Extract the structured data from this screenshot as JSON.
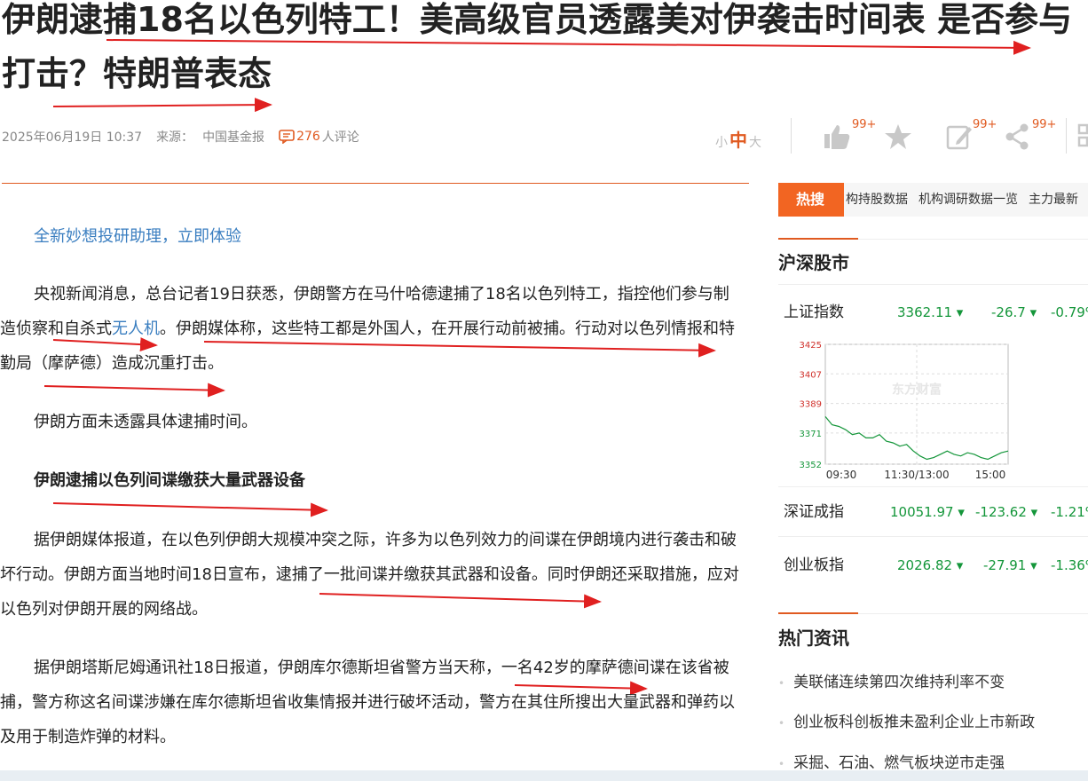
{
  "article": {
    "title": "伊朗逮捕18名以色列特工！美高级官员透露美对伊袭击时间表 是否参与打击？特朗普表态",
    "date": "2025年06月19日 10:37",
    "source_label": "来源：",
    "source": "中国基金报",
    "comment_count": "276",
    "comment_suffix": "人评论",
    "promo_link": "全新妙想投研助理，立即体验",
    "p1_a": "央视新闻消息，总台记者19日获悉，伊朗警方在马什哈德逮捕了18名以色列特工，指控他们参与制造侦察和自杀式",
    "p1_link": "无人机",
    "p1_b": "。伊朗媒体称，这些特工都是外国人，在开展行动前被捕。行动对以色列情报和特勤局（摩萨德）造成沉重打击。",
    "p2": "伊朗方面未透露具体逮捕时间。",
    "subheading": "伊朗逮捕以色列间谍缴获大量武器设备",
    "p3": "据伊朗媒体报道，在以色列伊朗大规模冲突之际，许多为以色列效力的间谍在伊朗境内进行袭击和破坏行动。伊朗方面当地时间18日宣布，逮捕了一批间谍并缴获其武器和设备。同时伊朗还采取措施，应对以色列对伊朗开展的网络战。",
    "p4": "据伊朗塔斯尼姆通讯社18日报道，伊朗库尔德斯坦省警方当天称，一名42岁的摩萨德间谍在该省被捕，警方称这名间谍涉嫌在库尔德斯坦省收集情报并进行破坏活动，警方在其住所搜出大量武器和弹药以及用于制造炸弹的材料。"
  },
  "font_size": {
    "small": "小",
    "medium": "中",
    "large": "大"
  },
  "toolbar": {
    "like_count": "99+",
    "edit_count": "99+",
    "share_count": "99+"
  },
  "hot": {
    "tag": "热搜",
    "links": [
      "构持股数据",
      "机构调研数据一览",
      "主力最新"
    ]
  },
  "market": {
    "title": "沪深股市",
    "indices": [
      {
        "name": "上证指数",
        "value": "3362.11",
        "change": "-26.7",
        "pct": "-0.79%"
      },
      {
        "name": "深证成指",
        "value": "10051.97",
        "change": "-123.62",
        "pct": "-1.21%"
      },
      {
        "name": "创业板指",
        "value": "2026.82",
        "change": "-27.91",
        "pct": "-1.36%"
      }
    ],
    "chart": {
      "y_ticks": [
        "3425",
        "3407",
        "3389",
        "3371",
        "3352"
      ],
      "x_ticks": [
        "09:30",
        "11:30/13:00",
        "15:00"
      ],
      "watermark": "东方财富"
    }
  },
  "news": {
    "title": "热门资讯",
    "items": [
      "美联储连续第四次维持利率不变",
      "创业板科创板推未盈利企业上市新政",
      "采掘、石油、燃气板块逆市走强"
    ]
  },
  "colors": {
    "accent": "#e05a20",
    "down": "#14963a",
    "link": "#3a7ec0",
    "hot_tag": "#f26522"
  },
  "chart_data": {
    "type": "line",
    "title": "",
    "x": [
      "09:30",
      "11:30/13:00",
      "15:00"
    ],
    "ylim": [
      3352,
      3425
    ],
    "yticks": [
      3352,
      3371,
      3389,
      3407,
      3425
    ],
    "series": [
      {
        "values": [
          3381,
          3376,
          3375,
          3373,
          3370,
          3371,
          3368,
          3368,
          3370,
          3366,
          3365,
          3363,
          3364,
          3360,
          3357,
          3355,
          3356,
          3358,
          3360,
          3358,
          3357,
          3359,
          3358,
          3356,
          3355,
          3357,
          3359,
          3360
        ]
      }
    ]
  }
}
